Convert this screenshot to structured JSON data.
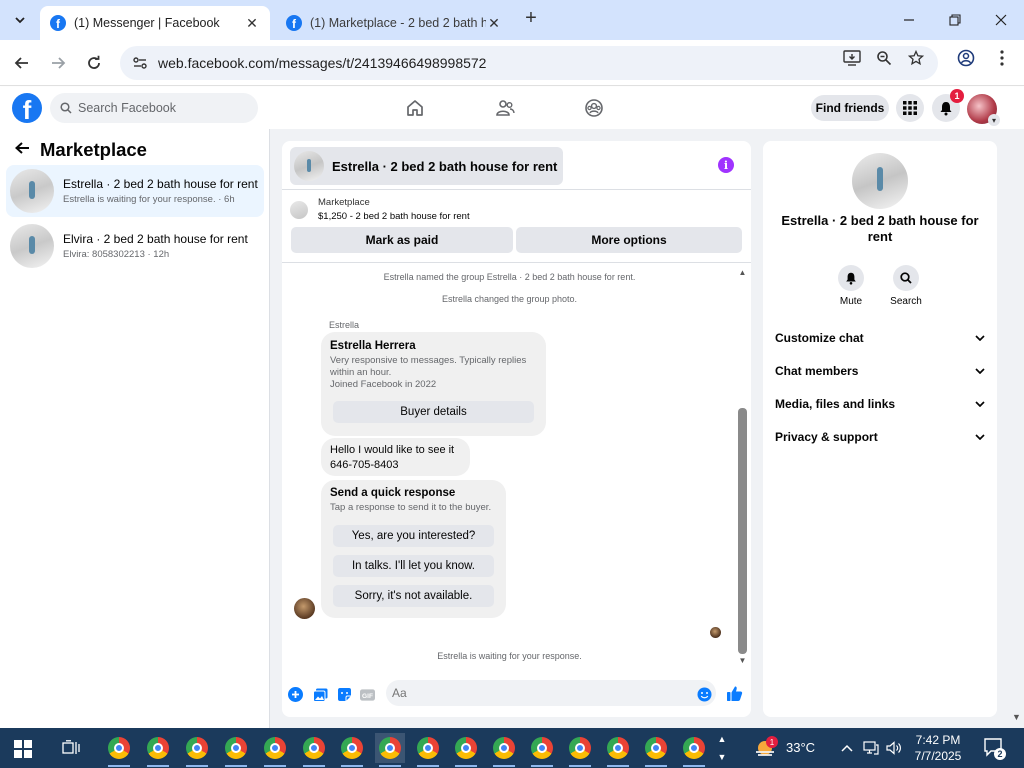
{
  "browser": {
    "tabs": [
      {
        "title": "(1) Messenger | Facebook",
        "active": true
      },
      {
        "title": "(1) Marketplace - 2 bed 2 bath h",
        "active": false
      }
    ],
    "url": "web.facebook.com/messages/t/24139466498998572"
  },
  "fb_header": {
    "search_placeholder": "Search Facebook",
    "find_friends": "Find friends",
    "notification_count": "1"
  },
  "left_panel": {
    "title": "Marketplace",
    "conversations": [
      {
        "name": "Estrella · 2 bed 2 bath house for rent",
        "sub": "Estrella is waiting for your response. · 6h",
        "active": true
      },
      {
        "name": "Elvira · 2 bed 2 bath house for rent",
        "sub": "Elvira: 8058302213 · 12h",
        "active": false
      }
    ]
  },
  "chat": {
    "header_title": "Estrella · 2 bed 2 bath house for rent",
    "marketplace_label": "Marketplace",
    "listing": "$1,250 - 2 bed 2 bath house for rent",
    "mark_paid": "Mark as paid",
    "more_options": "More options",
    "system_messages": [
      "Estrella named the group Estrella · 2 bed 2 bath house for rent.",
      "Estrella changed the group photo."
    ],
    "sender": "Estrella",
    "profile_card": {
      "name": "Estrella Herrera",
      "line1": "Very responsive to messages. Typically replies",
      "line2": "within an hour.",
      "line3": "Joined Facebook in 2022",
      "button": "Buyer details"
    },
    "message": {
      "line1": "Hello I would like to see it",
      "line2": "646-705-8403"
    },
    "quick_response": {
      "title": "Send a quick response",
      "subtitle": "Tap a response to send it to the buyer.",
      "options": [
        "Yes, are you interested?",
        "In talks. I'll let you know.",
        "Sorry, it's not available."
      ]
    },
    "waiting": "Estrella is waiting for your response.",
    "composer_placeholder": "Aa"
  },
  "right_panel": {
    "name": "Estrella · 2 bed 2 bath house for rent",
    "actions": [
      {
        "label": "Mute",
        "icon": "bell-icon"
      },
      {
        "label": "Search",
        "icon": "search-icon"
      }
    ],
    "sections": [
      "Customize chat",
      "Chat members",
      "Media, files and links",
      "Privacy & support"
    ]
  },
  "taskbar": {
    "temperature": "33°C",
    "time": "7:42 PM",
    "date": "7/7/2025",
    "weather_badge": "1",
    "notification_count": "2"
  },
  "colors": {
    "facebook_blue": "#1877f2",
    "messenger_purple": "#a033ff",
    "taskbar": "#1b3a5c",
    "tab_strip": "#d3e3fd"
  }
}
